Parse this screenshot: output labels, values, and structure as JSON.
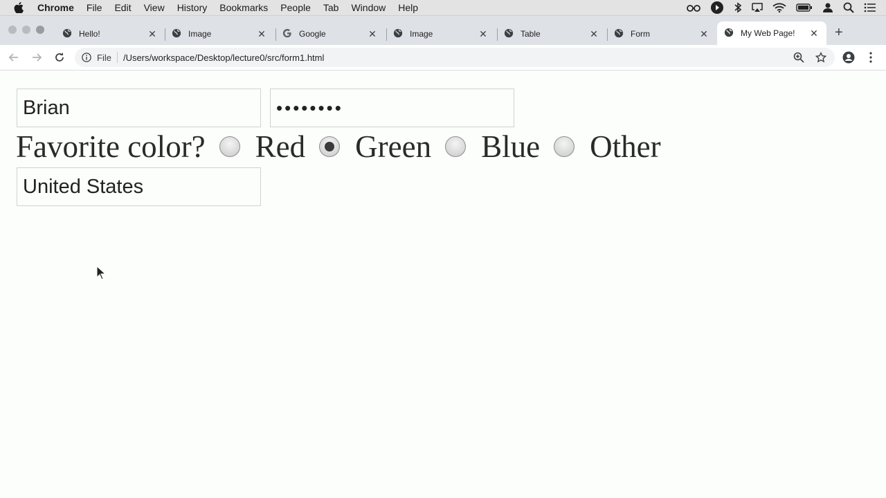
{
  "menubar": {
    "items": [
      "Chrome",
      "File",
      "Edit",
      "View",
      "History",
      "Bookmarks",
      "People",
      "Tab",
      "Window",
      "Help"
    ]
  },
  "tabs": [
    {
      "title": "Hello!",
      "icon": "globe-icon",
      "active": false
    },
    {
      "title": "Image",
      "icon": "globe-icon",
      "active": false
    },
    {
      "title": "Google",
      "icon": "google-icon",
      "active": false
    },
    {
      "title": "Image",
      "icon": "globe-icon",
      "active": false
    },
    {
      "title": "Table",
      "icon": "globe-icon",
      "active": false
    },
    {
      "title": "Form",
      "icon": "globe-icon",
      "active": false
    },
    {
      "title": "My Web Page!",
      "icon": "globe-icon",
      "active": true
    }
  ],
  "toolbar": {
    "file_label": "File",
    "url": "/Users/workspace/Desktop/lecture0/src/form1.html"
  },
  "form": {
    "name_value": "Brian",
    "password_value": "••••••••",
    "color_label": "Favorite color?",
    "colors": [
      {
        "label": "Red",
        "checked": false
      },
      {
        "label": "Green",
        "checked": true
      },
      {
        "label": "Blue",
        "checked": false
      },
      {
        "label": "Other",
        "checked": false
      }
    ],
    "country_value": "United States"
  }
}
